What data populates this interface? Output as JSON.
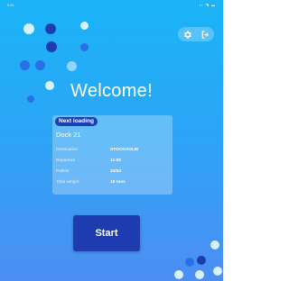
{
  "app": {
    "title": "Welcome!"
  },
  "status_bar": {
    "time": "9:41",
    "icons": "▪▪ ◥ ▬"
  },
  "actions": {
    "settings_icon": "gear-icon",
    "logout_icon": "logout-icon"
  },
  "next_loading": {
    "badge": "Next loading",
    "dock": "Dock 21",
    "rows": [
      {
        "label": "Destination",
        "value": "STOCKHOLM"
      },
      {
        "label": "Departure",
        "value": "11:00"
      },
      {
        "label": "Pallets",
        "value": "33/33"
      },
      {
        "label": "Total weight",
        "value": "19 tons"
      }
    ]
  },
  "start_button": {
    "label": "Start"
  },
  "colors": {
    "background_top": "#1ab4f7",
    "background_bottom": "#4d8ef2",
    "dot_navy": "#1f3bb0",
    "dot_blue": "#2a6fe8",
    "dot_light": "#d8f1ff",
    "button": "#1f3bb0",
    "badge": "#1a3fb0"
  }
}
